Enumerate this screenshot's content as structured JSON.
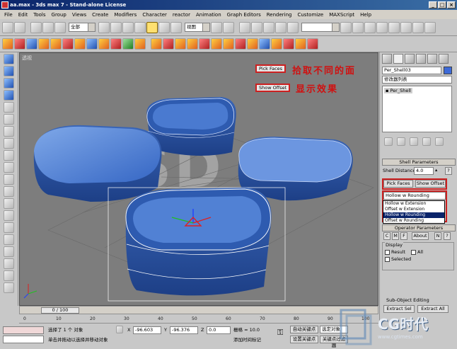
{
  "window": {
    "title": "aa.max - 3ds max 7 - Stand-alone License"
  },
  "menu": [
    "File",
    "Edit",
    "Tools",
    "Group",
    "Views",
    "Create",
    "Modifiers",
    "Character",
    "reactor",
    "Animation",
    "Graph Editors",
    "Rendering",
    "Customize",
    "MAXScript",
    "Help"
  ],
  "toolbar": {
    "selection_filter": "全部",
    "ref_coord": "视图"
  },
  "viewport": {
    "label": "透视",
    "watermark": "HXSD",
    "annotations": {
      "pick_faces_btn": "Pick Faces",
      "pick_faces_note": "拾取不同的面",
      "show_offset_btn": "Show Offset",
      "show_offset_note": "显示效果"
    }
  },
  "time": {
    "slider": "0 / 100",
    "ticks": [
      "0",
      "10",
      "20",
      "30",
      "40",
      "50",
      "60",
      "70",
      "80",
      "90",
      "100"
    ]
  },
  "status": {
    "selected": "选择了 1 个 对象",
    "prompt": "单击并拖动以选择并移动对象",
    "x_label": "X",
    "x_value": "-96.603",
    "y_label": "Y",
    "y_value": "-96.376",
    "z_label": "Z",
    "z_value": "0.0",
    "grid": "栅格 = 10.0",
    "add_time_tag": "添加时间标记",
    "auto_key": "自动关键点",
    "set_key": "设置关键点",
    "selected_dd": "选定对象",
    "key_filter": "关键点过滤器"
  },
  "panel": {
    "object_name": "Per_Shell03",
    "modifier_list": "修改器列表",
    "stack_item": "Per_Shell",
    "shell_rollout": "Shell Parameters",
    "shell_distance_label": "Shell Distance:",
    "shell_distance": "4.0",
    "pick_faces": "Pick Faces",
    "show_offset": "Show Offset",
    "dropdown_value": "Hollow w Rounding",
    "dropdown_options": [
      "Hollow w Extension",
      "Offset w Extension",
      "Hollow w Rounding",
      "Offset w Rounding"
    ],
    "dropdown_selected_index": 2,
    "operator_rollout": "Operator Parameters",
    "op_c": "C",
    "op_m": "M",
    "op_f": "F",
    "about": "About",
    "op_n": "N",
    "help": "?",
    "display_label": "Display",
    "result": "Result",
    "all": "All",
    "selected": "Selected",
    "subobj_rollout": "Sub-Object Editing",
    "extract_sel": "Extract Sel",
    "extract_all": "Extract All"
  },
  "logo": {
    "text": "CG时代",
    "url": "www.cgtimes.com"
  }
}
